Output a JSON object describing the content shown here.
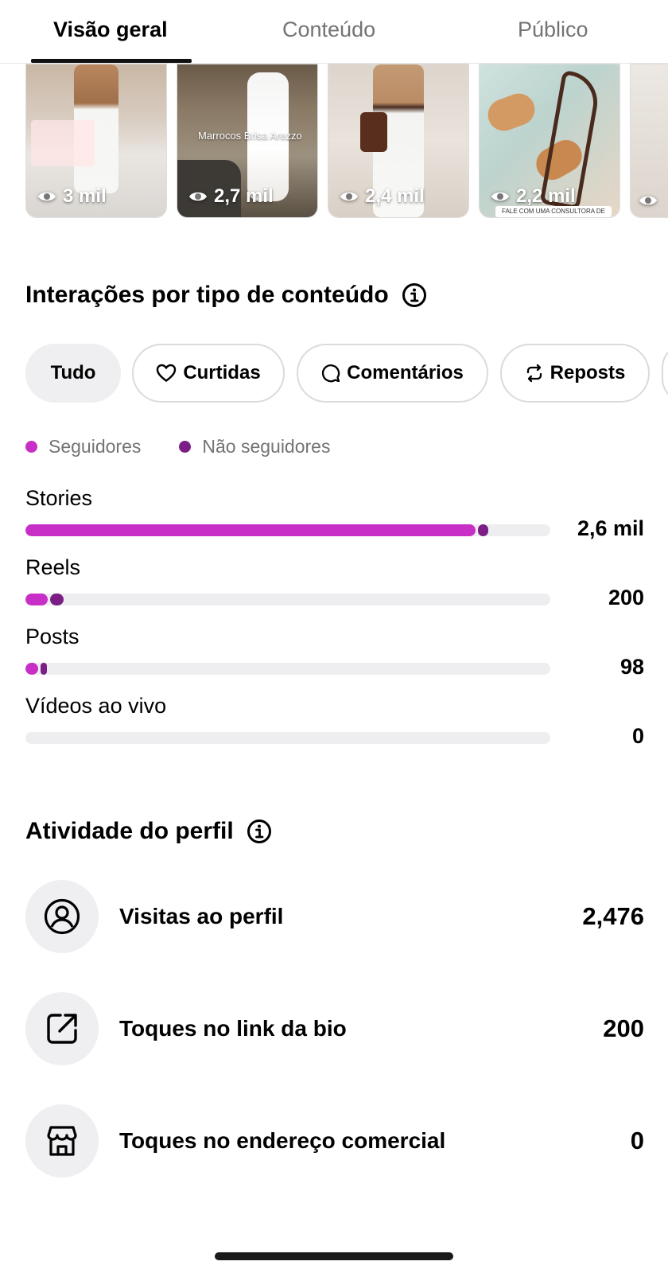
{
  "tabs": [
    {
      "label": "Visão geral",
      "active": true
    },
    {
      "label": "Conteúdo",
      "active": false
    },
    {
      "label": "Público",
      "active": false
    }
  ],
  "thumbnails": [
    {
      "views": "3 mil"
    },
    {
      "views": "2,7 mil",
      "overlay": "Marrocos Brisa Arezzo"
    },
    {
      "views": "2,4 mil"
    },
    {
      "views": "2,2 mil",
      "banner": "FALE COM UMA CONSULTORA DE VENDAS!"
    }
  ],
  "interactions": {
    "title": "Interações por tipo de conteúdo",
    "chips": [
      "Tudo",
      "Curtidas",
      "Comentários",
      "Reposts"
    ],
    "legend": {
      "followers": "Seguidores",
      "non_followers": "Não seguidores"
    },
    "colors": {
      "followers": "#c72fc7",
      "non_followers": "#7b1f86",
      "track": "#eeeef1"
    }
  },
  "chart_data": {
    "type": "bar",
    "orientation": "horizontal",
    "stacked": true,
    "categories": [
      "Stories",
      "Reels",
      "Posts",
      "Vídeos ao vivo"
    ],
    "value_labels": [
      "2,6 mil",
      "200",
      "98",
      "0"
    ],
    "values": [
      2600,
      200,
      98,
      0
    ],
    "series": [
      {
        "name": "Seguidores",
        "values": [
          2540,
          125,
          70,
          0
        ]
      },
      {
        "name": "Não seguidores",
        "values": [
          60,
          75,
          28,
          0
        ]
      }
    ],
    "xlim": [
      0,
      2960
    ]
  },
  "profile_activity": {
    "title": "Atividade do perfil",
    "items": [
      {
        "label": "Visitas ao perfil",
        "value": "2,476",
        "icon": "user-circle-icon"
      },
      {
        "label": "Toques no link da bio",
        "value": "200",
        "icon": "external-link-icon"
      },
      {
        "label": "Toques no endereço comercial",
        "value": "0",
        "icon": "storefront-icon"
      }
    ]
  }
}
